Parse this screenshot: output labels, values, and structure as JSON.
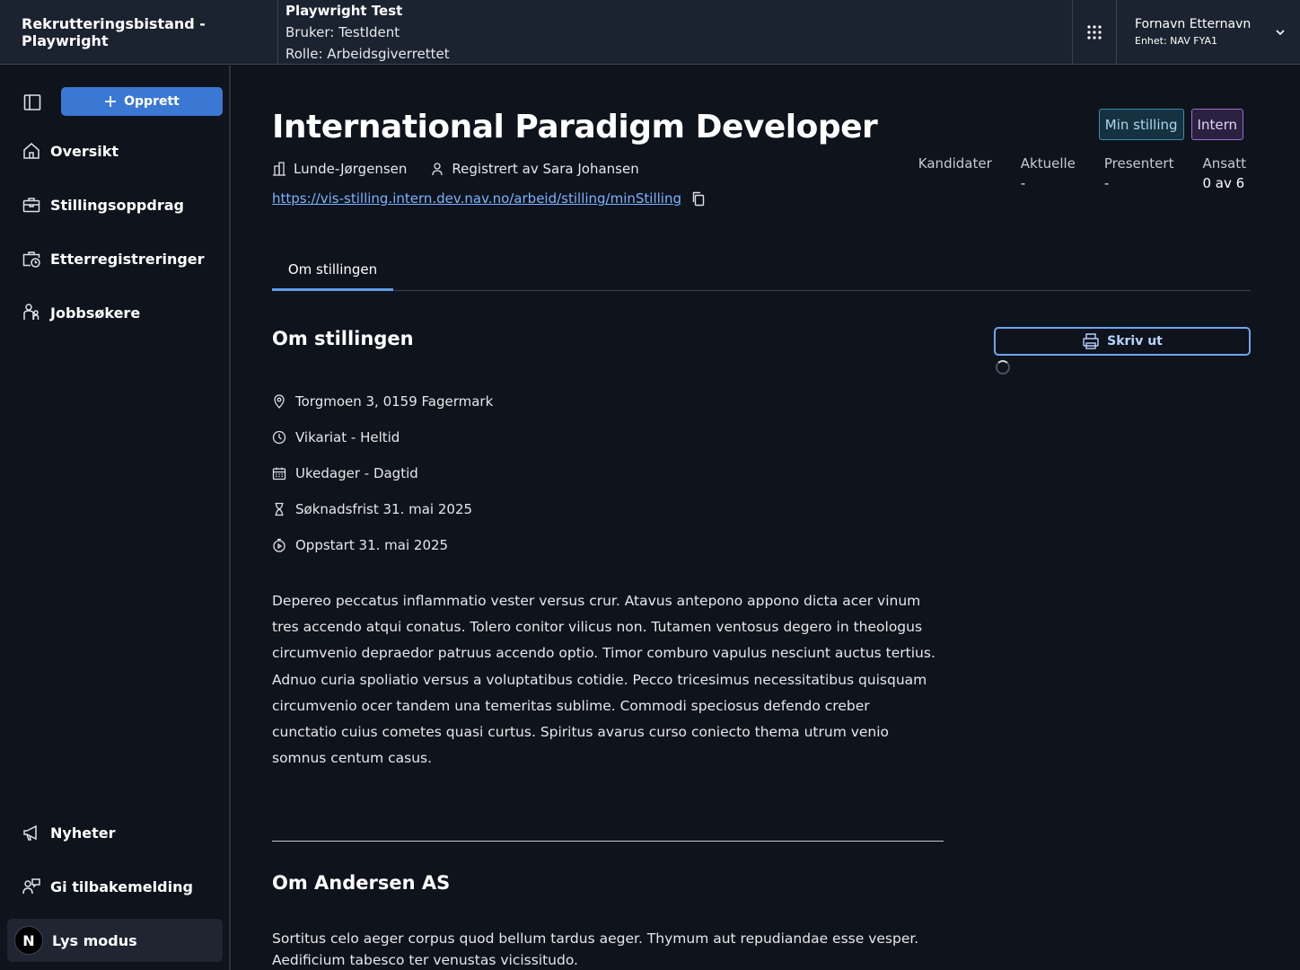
{
  "header": {
    "app_title": "Rekrutteringsbistand - Playwright",
    "env_title": "Playwright Test",
    "env_user": "Bruker: TestIdent",
    "env_role": "Rolle: Arbeidsgiverrettet",
    "user_name": "Fornavn Etternavn",
    "user_unit": "Enhet: NAV FYA1"
  },
  "sidebar": {
    "create_label": "Opprett",
    "items": [
      {
        "label": "Oversikt",
        "icon": "house-icon"
      },
      {
        "label": "Stillingsoppdrag",
        "icon": "briefcase-icon"
      },
      {
        "label": "Etterregistreringer",
        "icon": "briefcase-clock-icon"
      },
      {
        "label": "Jobbsøkere",
        "icon": "persons-icon"
      }
    ],
    "bottom_items": [
      {
        "label": "Nyheter",
        "icon": "megaphone-icon"
      },
      {
        "label": "Gi tilbakemelding",
        "icon": "person-chat-icon"
      },
      {
        "label": "Lys modus",
        "icon": "theme-n-icon"
      }
    ],
    "theme_glyph": "N"
  },
  "main": {
    "title": "International Paradigm Developer",
    "employer": "Lunde-Jørgensen",
    "registered_by": "Registrert av Sara Johansen",
    "link": "https://vis-stilling.intern.dev.nav.no/arbeid/stilling/minStilling",
    "badges": {
      "min": "Min stilling",
      "intern": "Intern"
    },
    "stats": [
      {
        "label": "Kandidater",
        "value": ""
      },
      {
        "label": "Aktuelle",
        "value": "-"
      },
      {
        "label": "Presentert",
        "value": "-"
      },
      {
        "label": "Ansatt",
        "value": "0 av 6"
      }
    ],
    "tab": "Om stillingen",
    "section_title": "Om stillingen",
    "print_label": "Skriv ut",
    "facts": [
      {
        "icon": "location-pin-icon",
        "text": "Torgmoen 3, 0159 Fagermark"
      },
      {
        "icon": "clock-icon",
        "text": "Vikariat - Heltid"
      },
      {
        "icon": "calendar-icon",
        "text": "Ukedager - Dagtid"
      },
      {
        "icon": "hourglass-icon",
        "text": "Søknadsfrist 31. mai 2025"
      },
      {
        "icon": "stopwatch-icon",
        "text": "Oppstart 31. mai 2025"
      }
    ],
    "description": "Depereo peccatus inflammatio vester versus crur. Atavus antepono appono dicta acer vinum tres accendo atqui conatus. Tolero conitor vilicus non. Tutamen ventosus degero in theologus circumvenio depraedor patruus accendo optio. Timor comburo vapulus nesciunt auctus tertius. Adnuo curia spoliatio versus a voluptatibus cotidie. Pecco tricesimus necessitatibus quisquam circumvenio ocer tandem una temeritas sublime. Commodi speciosus defendo creber cunctatio cuius cometes quasi curtus. Spiritus avarus curso coniecto thema utrum venio somnus centum casus.",
    "company_title": "Om Andersen AS",
    "company_description": "Sortitus celo aeger corpus quod bellum tardus aeger. Thymum aut repudiandae esse vesper. Aedificium tabesco ter venustas vicissitudo."
  }
}
